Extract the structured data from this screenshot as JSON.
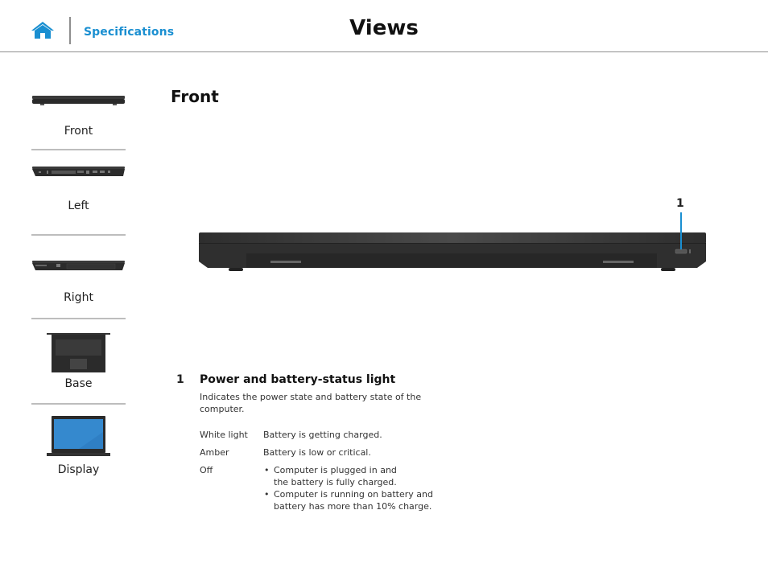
{
  "header": {
    "home_icon": "home-icon",
    "specifications_link": "Specifications",
    "title": "Views"
  },
  "sidebar": {
    "items": [
      {
        "label": "Front",
        "thumbnail": "laptop-front-thumbnail"
      },
      {
        "label": "Left",
        "thumbnail": "laptop-left-thumbnail"
      },
      {
        "label": "Right",
        "thumbnail": "laptop-right-thumbnail"
      },
      {
        "label": "Base",
        "thumbnail": "laptop-base-thumbnail"
      },
      {
        "label": "Display",
        "thumbnail": "laptop-display-thumbnail"
      }
    ]
  },
  "main": {
    "section_title": "Front",
    "callout_label": "1",
    "items": [
      {
        "number": "1",
        "title": "Power and battery-status light",
        "description": "Indicates the power state and battery state of the computer.",
        "states": [
          {
            "state": "White light",
            "meaning": [
              "Battery is getting charged."
            ]
          },
          {
            "state": "Amber",
            "meaning": [
              "Battery is low or critical."
            ]
          },
          {
            "state": "Off",
            "meaning": [
              "Computer is plugged in and the battery is fully charged.",
              "Computer is running on battery and battery has more than 10% charge."
            ]
          }
        ]
      }
    ]
  },
  "colors": {
    "accent": "#1a8fd1",
    "divider": "#8f8f8f"
  }
}
